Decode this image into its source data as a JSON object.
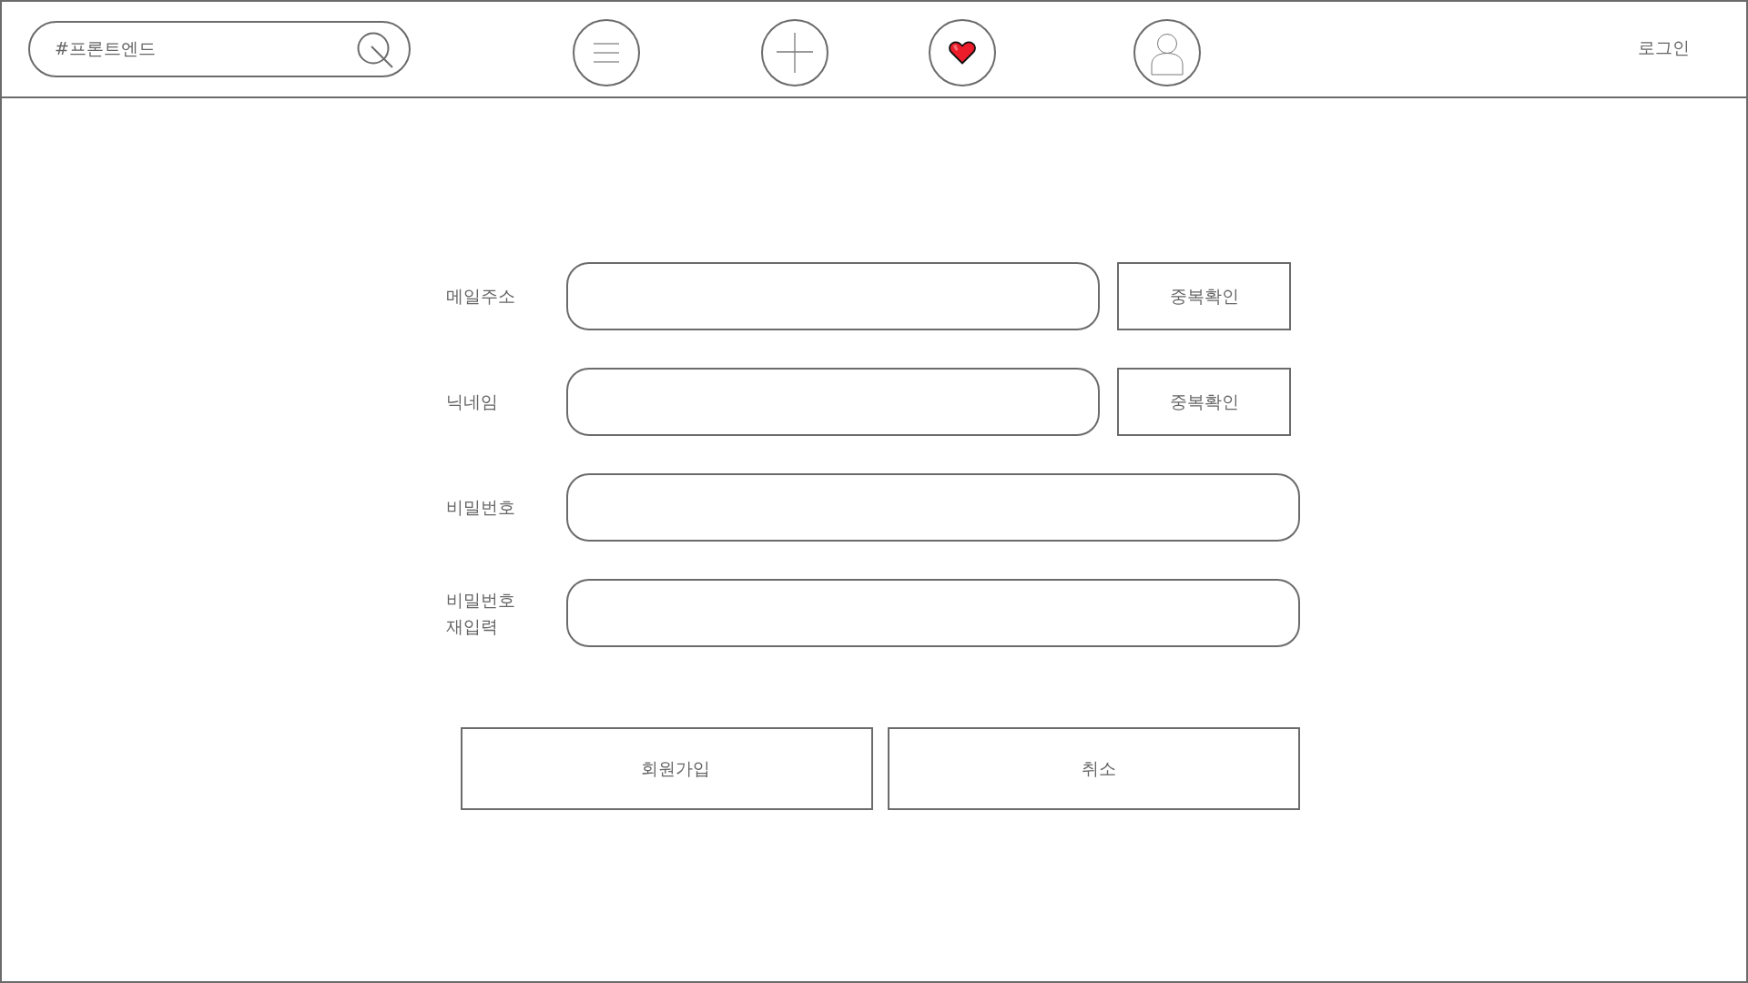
{
  "header": {
    "search": {
      "value": "#프론트엔드"
    },
    "login_link": "로그인"
  },
  "form": {
    "fields": [
      {
        "label": "메일주소",
        "button": "중복확인"
      },
      {
        "label": "닉네임",
        "button": "중복확인"
      },
      {
        "label": "비밀번호"
      },
      {
        "label": "비밀번호 재입력"
      }
    ],
    "buttons": [
      "회원가입",
      "취소"
    ]
  }
}
